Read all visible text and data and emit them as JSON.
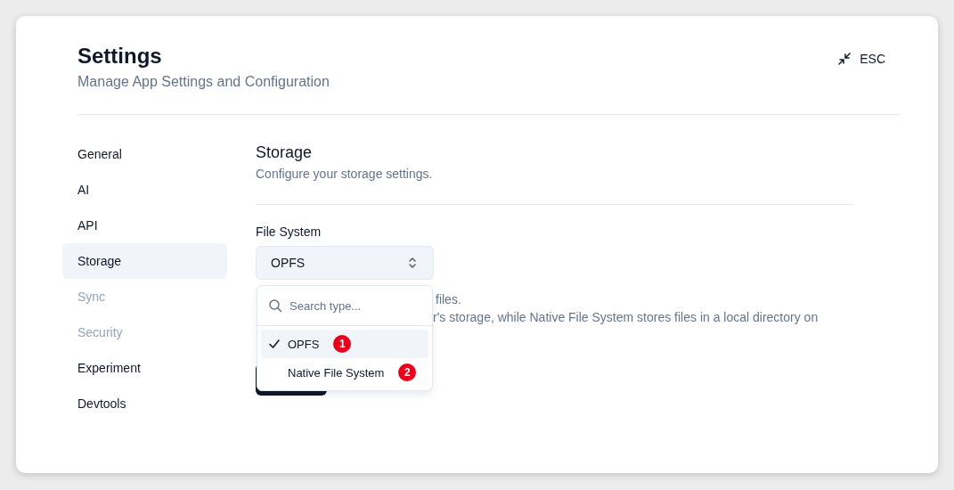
{
  "header": {
    "title": "Settings",
    "subtitle": "Manage App Settings and Configuration",
    "exit_label": "ESC"
  },
  "sidebar": {
    "items": [
      {
        "label": "General",
        "selected": false,
        "disabled": false
      },
      {
        "label": "AI",
        "selected": false,
        "disabled": false
      },
      {
        "label": "API",
        "selected": false,
        "disabled": false
      },
      {
        "label": "Storage",
        "selected": true,
        "disabled": false
      },
      {
        "label": "Sync",
        "selected": false,
        "disabled": true
      },
      {
        "label": "Security",
        "selected": false,
        "disabled": true
      },
      {
        "label": "Experiment",
        "selected": false,
        "disabled": false
      },
      {
        "label": "Devtools",
        "selected": false,
        "disabled": false
      }
    ]
  },
  "section": {
    "title": "Storage",
    "description": "Configure your storage settings."
  },
  "field": {
    "label": "File System",
    "value": "OPFS",
    "help_lines": [
      "files.",
      "r's storage, while Native File System stores files in a local directory on"
    ]
  },
  "dropdown": {
    "placeholder": "Search type...",
    "options": [
      {
        "label": "OPFS",
        "selected": true,
        "badge": "1"
      },
      {
        "label": "Native File System",
        "selected": false,
        "badge": "2"
      }
    ]
  }
}
